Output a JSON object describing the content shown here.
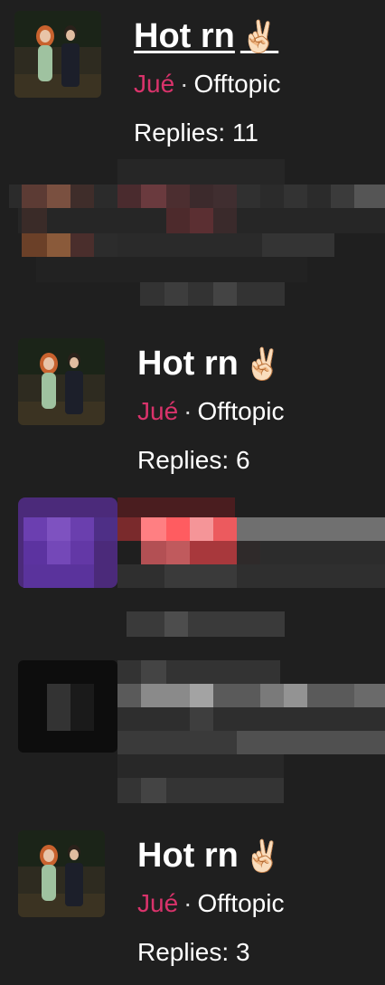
{
  "threads": [
    {
      "title": "Hot rn",
      "emoji": "✌🏻",
      "author": "Jué",
      "separator": "·",
      "category": "Offtopic",
      "replies": "Replies: 11"
    },
    {
      "title": "Hot rn",
      "emoji": "✌🏻",
      "author": "Jué",
      "separator": "·",
      "category": "Offtopic",
      "replies": "Replies: 6"
    },
    {
      "title": "Hot rn",
      "emoji": "✌🏻",
      "author": "Jué",
      "separator": "·",
      "category": "Offtopic",
      "replies": "Replies: 3"
    }
  ],
  "colors": {
    "background": "#1f1f1f",
    "author": "#d9336b",
    "text": "#ffffff"
  },
  "icons": {
    "thumbnail": "couple-photo-thumbnail",
    "redacted": "pixelated-redaction"
  }
}
